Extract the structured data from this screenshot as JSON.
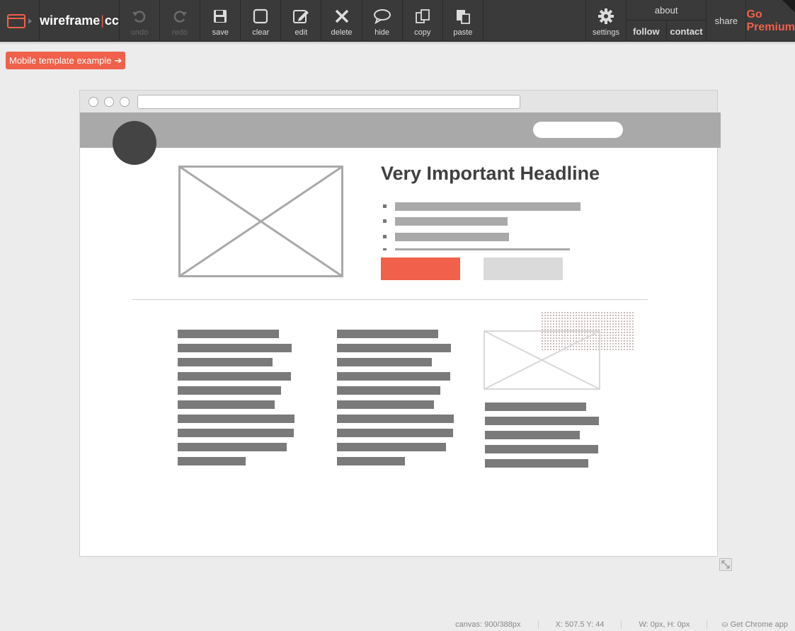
{
  "toolbar": {
    "brand": {
      "part1": "wireframe",
      "sep": "|",
      "part2": "cc"
    },
    "buttons": [
      {
        "label": "undo",
        "icon": "undo-icon",
        "disabled": true
      },
      {
        "label": "redo",
        "icon": "redo-icon",
        "disabled": true
      },
      {
        "label": "save",
        "icon": "save-icon",
        "disabled": false
      },
      {
        "label": "clear",
        "icon": "clear-icon",
        "disabled": false
      },
      {
        "label": "edit",
        "icon": "edit-icon",
        "disabled": false
      },
      {
        "label": "delete",
        "icon": "delete-icon",
        "disabled": false
      },
      {
        "label": "hide",
        "icon": "hide-icon",
        "disabled": false
      },
      {
        "label": "copy",
        "icon": "copy-icon",
        "disabled": false
      },
      {
        "label": "paste",
        "icon": "paste-icon",
        "disabled": false
      },
      {
        "label": "settings",
        "icon": "gear-icon",
        "disabled": false
      }
    ],
    "about": "about",
    "follow": "follow",
    "contact": "contact",
    "share": "share",
    "premium": "Go Premium"
  },
  "template_tag": {
    "label": "Mobile template example",
    "arrow": "➔"
  },
  "wireframe": {
    "headline": "Very Important Headline"
  },
  "status": {
    "canvas": "canvas: 900/388px",
    "coords": "X: 507.5 Y: 44",
    "size": "W: 0px, H: 0px",
    "chrome_app": "Get Chrome app"
  },
  "colors": {
    "toolbar_bg": "#3a3a3a",
    "accent": "#f0604a",
    "placeholder_gray": "#a9a9a9",
    "text_bar_gray": "#7a7a7a"
  }
}
